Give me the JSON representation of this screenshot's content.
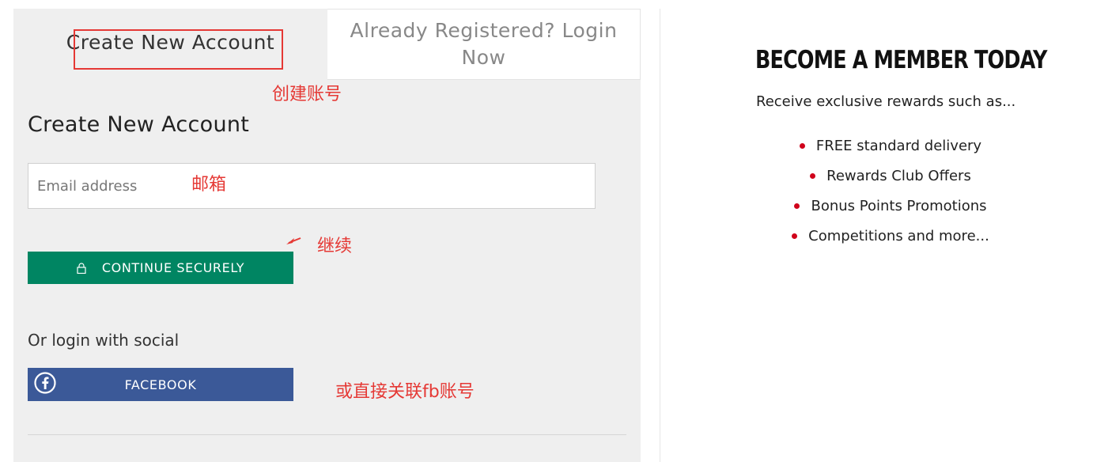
{
  "tabs": {
    "create_label": "Create New Account",
    "login_label": "Already Registered? Login Now"
  },
  "form": {
    "heading": "Create New Account",
    "email_placeholder": "Email address",
    "continue_label": "CONTINUE SECURELY",
    "continue_icon": "lock-icon",
    "social_label": "Or login with social",
    "facebook_label": "FACEBOOK",
    "facebook_icon": "facebook-icon"
  },
  "annotations": {
    "create_account": "创建账号",
    "email": "邮箱",
    "continue": "继续",
    "facebook": "或直接关联fb账号"
  },
  "membership": {
    "title": "BECOME A MEMBER TODAY",
    "subtitle": "Receive exclusive rewards such as...",
    "benefits": [
      "FREE standard delivery",
      "Rewards Club Offers",
      "Bonus Points Promotions",
      "Competitions and more..."
    ]
  },
  "colors": {
    "continue_green": "#008562",
    "facebook_blue": "#3b5998",
    "bullet_red": "#d0021b",
    "annotation_red": "#e53935"
  }
}
